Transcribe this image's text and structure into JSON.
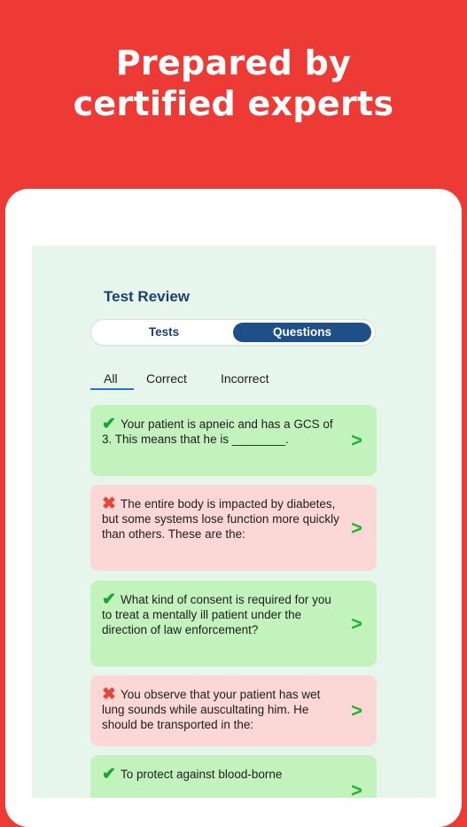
{
  "headline": {
    "line1": "Prepared by",
    "line2": "certified experts"
  },
  "screen": {
    "title": "Test Review",
    "segments": [
      {
        "label": "Tests",
        "selected": false
      },
      {
        "label": "Questions",
        "selected": true
      }
    ],
    "filters": [
      {
        "label": "All",
        "selected": true
      },
      {
        "label": "Correct",
        "selected": false
      },
      {
        "label": "Incorrect",
        "selected": false
      }
    ],
    "questions": [
      {
        "status": "correct",
        "icon": "check-icon",
        "text": "Your patient is apneic and has a GCS of 3. This means that he is ________."
      },
      {
        "status": "incorrect",
        "icon": "cross-icon",
        "text": "The entire body is impacted by diabetes, but some systems lose function more quickly than others. These are the:"
      },
      {
        "status": "correct",
        "icon": "check-icon",
        "text": "What kind of consent is required for you to treat a mentally ill patient under the direction of law enforcement?"
      },
      {
        "status": "incorrect",
        "icon": "cross-icon",
        "text": "You observe that your patient has wet lung sounds while auscultating him. He should be transported in the:"
      },
      {
        "status": "correct",
        "icon": "check-icon",
        "text": "To protect against blood-borne"
      }
    ]
  },
  "colors": {
    "brand_red": "#ee3a35",
    "navy": "#1e4f86",
    "correct_bg": "#c2f3bd",
    "incorrect_bg": "#fbd7d5",
    "check_green": "#1aa332",
    "cross_red": "#e8443a"
  }
}
